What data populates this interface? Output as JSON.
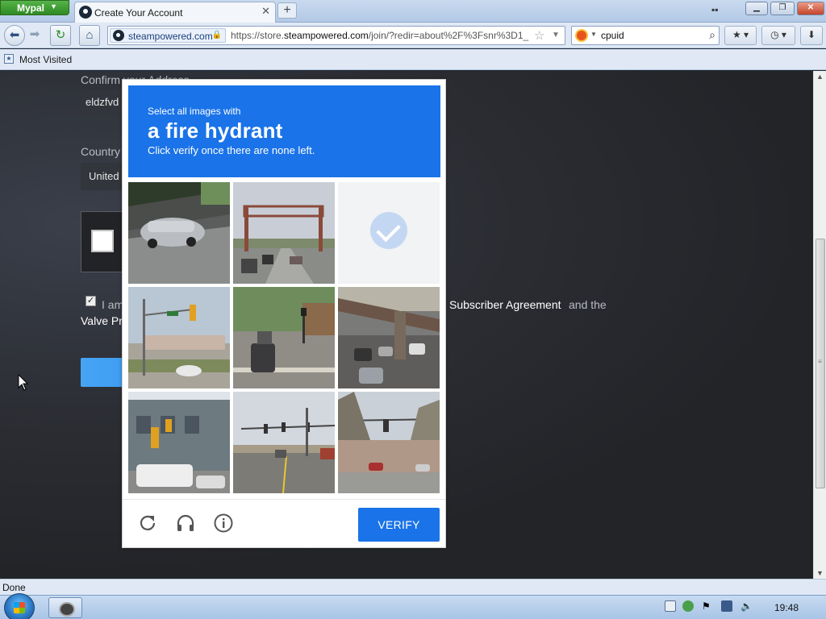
{
  "browser": {
    "app_button": "Mypal",
    "tab_title": "Create Your Account",
    "tab_close": "✕",
    "new_tab": "+",
    "url_host": "steampowered.com",
    "url_prefix": "https://store.",
    "url_domain": "steampowered.com",
    "url_rest": "/join/?redir=about%2F%3Fsnr%3D1_",
    "search_value": "cpuid",
    "bookmarks_bar_item": "Most Visited",
    "status": "Done"
  },
  "page": {
    "confirm_label": "Confirm your Address",
    "confirm_value": "eldzfvd",
    "country_label": "Country",
    "country_value": "United",
    "agree_prefix": "I am",
    "agree_link_subscriber": "Subscriber Agreement",
    "agree_and": "and the",
    "agree_link_valve": "Valve Pr"
  },
  "captcha": {
    "select_text": "Select all images with",
    "object": "a fire hydrant",
    "instruction": "Click verify once there are none left.",
    "tiles": [
      {
        "scene": "car-under-overpass"
      },
      {
        "scene": "highway-sign-gantry"
      },
      {
        "scene": "selected-blank"
      },
      {
        "scene": "intersection-traffic-light"
      },
      {
        "scene": "street-with-cars"
      },
      {
        "scene": "overpass-traffic"
      },
      {
        "scene": "building-with-traffic-light"
      },
      {
        "scene": "road-intersection"
      },
      {
        "scene": "shopping-lot-traffic-light"
      }
    ],
    "verify_label": "VERIFY"
  },
  "taskbar": {
    "clock": "19:48"
  },
  "colors": {
    "captcha_blue": "#1a73e8",
    "page_bg": "#25262a"
  }
}
